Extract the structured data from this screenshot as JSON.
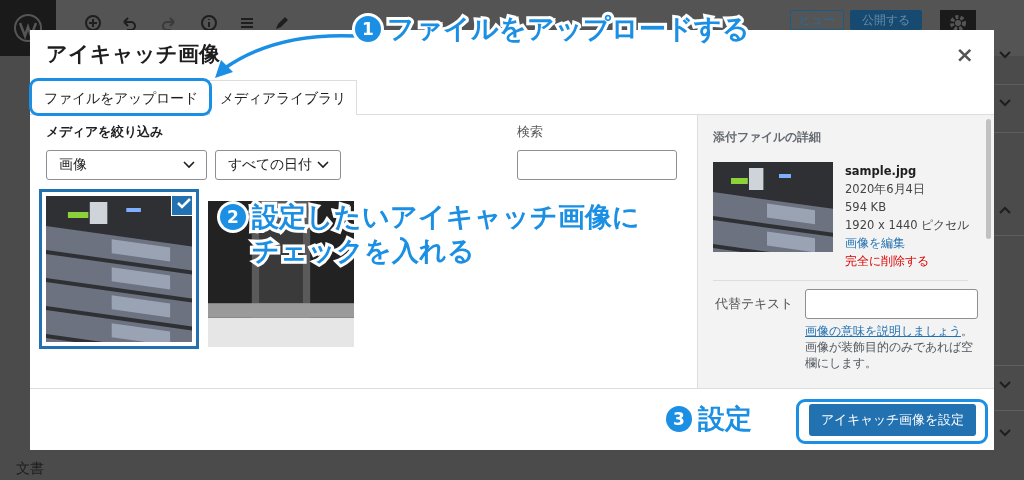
{
  "editor": {
    "toolbar_buttons": [
      {
        "label": "ビュー",
        "kind": "secondary"
      },
      {
        "label": "公開する",
        "kind": "primary"
      }
    ],
    "footer_label": "文書"
  },
  "modal": {
    "title": "アイキャッチ画像",
    "close": "×",
    "tabs": [
      {
        "label": "ファイルをアップロード",
        "selected": false
      },
      {
        "label": "メディアライブラリ",
        "selected": true
      }
    ],
    "filter": {
      "label": "メディアを絞り込み",
      "type_value": "画像",
      "date_value": "すべての日付"
    },
    "search": {
      "label": "検索"
    },
    "attachments": [
      {
        "selected": true
      },
      {
        "selected": false
      }
    ],
    "details": {
      "heading": "添付ファイルの詳細",
      "filename": "sample.jpg",
      "date": "2020年6月4日",
      "size": "594 KB",
      "dimensions": "1920 x 1440 ピクセル",
      "edit_link": "画像を編集",
      "delete_link": "完全に削除する",
      "alt_label": "代替テキスト",
      "help_link": "画像の意味を説明しましょう",
      "help_text": "。画像が装飾目的のみであれば空欄にします。"
    },
    "button": "アイキャッチ画像を設定"
  },
  "annotations": [
    {
      "number": "1",
      "lines": [
        "ファイルをアップロードする"
      ]
    },
    {
      "number": "2",
      "lines": [
        "設定したいアイキャッチ画像に",
        "チェックを入れる"
      ]
    },
    {
      "number": "3",
      "lines": [
        "設定"
      ]
    }
  ]
}
